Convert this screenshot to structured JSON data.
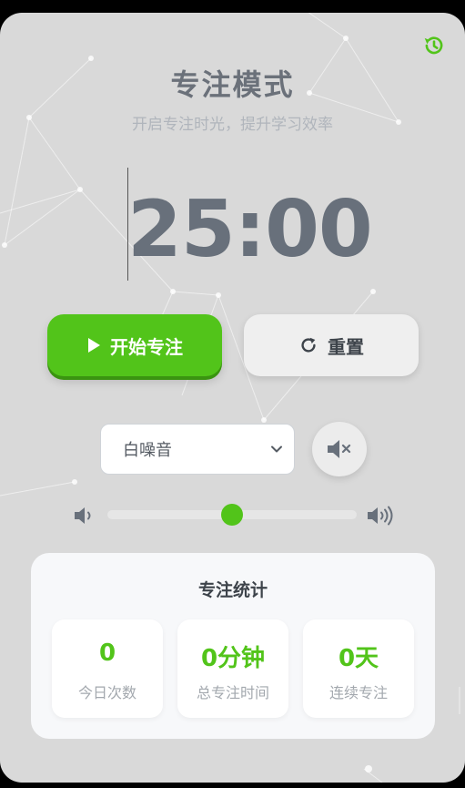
{
  "header": {
    "title": "专注模式",
    "subtitle": "开启专注时光，提升学习效率"
  },
  "timer": {
    "display": "25:00"
  },
  "controls": {
    "start_label": "开始专注",
    "reset_label": "重置"
  },
  "sound": {
    "selected": "白噪音",
    "muted": true,
    "volume": 0.5
  },
  "stats": {
    "title": "专注统计",
    "items": [
      {
        "value": "0",
        "label": "今日次数"
      },
      {
        "value": "0分钟",
        "label": "总专注时间"
      },
      {
        "value": "0天",
        "label": "连续专注"
      }
    ]
  },
  "colors": {
    "accent": "#52c41a",
    "background": "#d9d9d9",
    "text_muted": "#6b717a"
  },
  "icons": [
    "history-icon",
    "play-icon",
    "refresh-icon",
    "chevron-down-icon",
    "mute-icon",
    "volume-low-icon",
    "volume-high-icon"
  ]
}
